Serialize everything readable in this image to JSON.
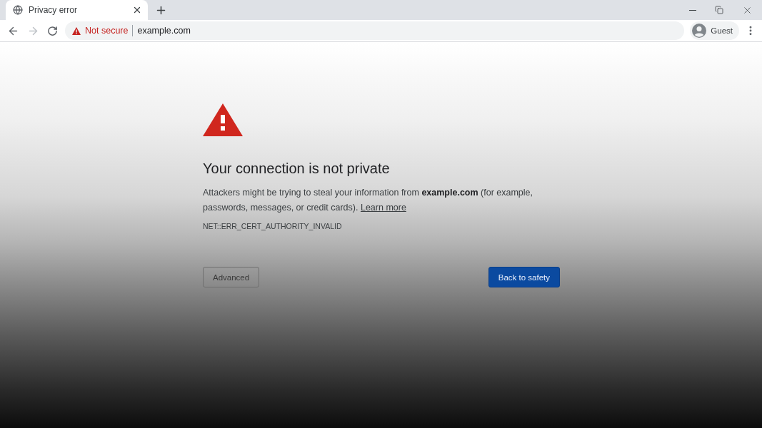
{
  "tabs": [
    {
      "title": "Privacy error",
      "selected": true
    }
  ],
  "toolbar": {
    "nav": [
      {
        "kind": "back",
        "disabled": false
      },
      {
        "kind": "forward",
        "disabled": true
      },
      {
        "kind": "reload",
        "disabled": false
      }
    ],
    "address": {
      "security_label": "Not secure",
      "url": "example.com"
    },
    "profile": {
      "label": "Guest"
    }
  },
  "page": {
    "heading": "Your connection is not private",
    "message": "Attackers might be trying to steal your information from **example.com** (for example, passwords, messages, or credit cards).",
    "learn_more": "Learn more",
    "error_code": "NET::ERR_CERT_AUTHORITY_INVALID",
    "buttons": [
      {
        "label": "Advanced",
        "kind": "secondary"
      },
      {
        "label": "Back to safety",
        "kind": "primary"
      }
    ]
  }
}
